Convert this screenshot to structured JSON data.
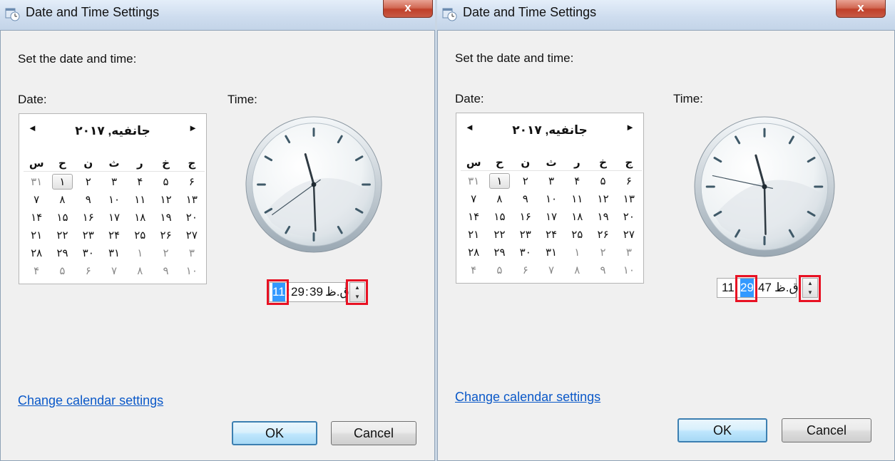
{
  "dialogs": [
    {
      "title": "Date and Time Settings",
      "close_label": "x",
      "heading": "Set the date and time:",
      "date_label": "Date:",
      "time_label": "Time:",
      "calendar": {
        "month_title": "جانفیه, ۲۰۱۷",
        "prev_arrow": "◄",
        "next_arrow": "►",
        "weekdays": [
          "ج",
          "خ",
          "ر",
          "ث",
          "ن",
          "ح",
          "س"
        ],
        "weeks": [
          [
            "۶",
            "۵",
            "۴",
            "۳",
            "۲",
            "۱",
            "۳۱"
          ],
          [
            "۱۳",
            "۱۲",
            "۱۱",
            "۱۰",
            "۹",
            "۸",
            "۷"
          ],
          [
            "۲۰",
            "۱۹",
            "۱۸",
            "۱۷",
            "۱۶",
            "۱۵",
            "۱۴"
          ],
          [
            "۲۷",
            "۲۶",
            "۲۵",
            "۲۴",
            "۲۳",
            "۲۲",
            "۲۱"
          ],
          [
            "۳",
            "۲",
            "۱",
            "۳۱",
            "۳۰",
            "۲۹",
            "۲۸"
          ],
          [
            "۱۰",
            "۹",
            "۸",
            "۷",
            "۶",
            "۵",
            "۴"
          ]
        ]
      },
      "clock": {
        "hours": 11,
        "minutes": 29,
        "seconds": 39
      },
      "time_field": {
        "hour": "11",
        "sep1": ":",
        "minute": "29",
        "sep2": ":",
        "second": "39",
        "ampm": "ق.ظ",
        "selected": "hour"
      },
      "link": "Change calendar settings",
      "ok_label": "OK",
      "cancel_label": "Cancel"
    },
    {
      "title": "Date and Time Settings",
      "close_label": "x",
      "heading": "Set the date and time:",
      "date_label": "Date:",
      "time_label": "Time:",
      "calendar": {
        "month_title": "جانفیه, ۲۰۱۷",
        "prev_arrow": "◄",
        "next_arrow": "►",
        "weekdays": [
          "ج",
          "خ",
          "ر",
          "ث",
          "ن",
          "ح",
          "س"
        ],
        "weeks": [
          [
            "۶",
            "۵",
            "۴",
            "۳",
            "۲",
            "۱",
            "۳۱"
          ],
          [
            "۱۳",
            "۱۲",
            "۱۱",
            "۱۰",
            "۹",
            "۸",
            "۷"
          ],
          [
            "۲۰",
            "۱۹",
            "۱۸",
            "۱۷",
            "۱۶",
            "۱۵",
            "۱۴"
          ],
          [
            "۲۷",
            "۲۶",
            "۲۵",
            "۲۴",
            "۲۳",
            "۲۲",
            "۲۱"
          ],
          [
            "۳",
            "۲",
            "۱",
            "۳۱",
            "۳۰",
            "۲۹",
            "۲۸"
          ],
          [
            "۱۰",
            "۹",
            "۸",
            "۷",
            "۶",
            "۵",
            "۴"
          ]
        ]
      },
      "clock": {
        "hours": 11,
        "minutes": 29,
        "seconds": 47
      },
      "time_field": {
        "hour": "11",
        "sep1": "",
        "minute": "29",
        "sep2": "",
        "second": "47",
        "ampm": "ق.ظ",
        "selected": "minute"
      },
      "link": "Change calendar settings",
      "ok_label": "OK",
      "cancel_label": "Cancel"
    }
  ]
}
